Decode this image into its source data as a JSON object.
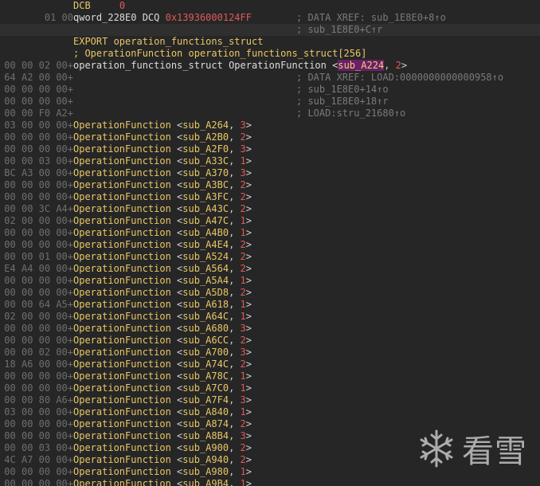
{
  "header_lines": [
    {
      "bytes": "",
      "segments": [
        {
          "t": "DCB",
          "c": "kw"
        },
        {
          "t": "     ",
          "c": "dec"
        },
        {
          "t": "0",
          "c": "num"
        }
      ],
      "comment": ""
    },
    {
      "bytes": "01 00",
      "segments": [
        {
          "t": "qword_228E0 DCQ ",
          "c": "name"
        },
        {
          "t": "0x13936000124FF",
          "c": "hex"
        }
      ],
      "comment": "; DATA XREF: sub_1E8E0+8↑o"
    },
    {
      "bytes": "",
      "segments": [],
      "comment": "; sub_1E8E0+C↑r"
    },
    {
      "bytes": "",
      "segments": [
        {
          "t": "EXPORT operation_functions_struct",
          "c": "kw"
        }
      ],
      "comment": ""
    },
    {
      "bytes": "",
      "segments": [
        {
          "t": "; OperationFunction operation_functions_struct[256]",
          "c": "kw"
        }
      ],
      "comment": ""
    },
    {
      "bytes": "00 00 02 00+",
      "segments": [
        {
          "t": "operation_functions_struct OperationFunction <",
          "c": "name"
        },
        {
          "t": "sub_A224",
          "c": "sub hilite"
        },
        {
          "t": ", ",
          "c": "punct"
        },
        {
          "t": "2",
          "c": "num"
        },
        {
          "t": ">",
          "c": "punct"
        }
      ],
      "comment": ""
    },
    {
      "bytes": "64 A2 00 00+",
      "segments": [],
      "comment": "; DATA XREF: LOAD:0000000000000958↑o"
    },
    {
      "bytes": "00 00 00 00+",
      "segments": [],
      "comment": "; sub_1E8E0+14↑o"
    },
    {
      "bytes": "00 00 00 00+",
      "segments": [],
      "comment": "; sub_1E8E0+18↑r"
    },
    {
      "bytes": "00 00 F0 A2+",
      "segments": [],
      "comment": "; LOAD:stru_21680↑o"
    }
  ],
  "entry_keyword": "OperationFunction",
  "entries": [
    {
      "bytes": "03 00 00 00+",
      "sub": "sub_A264",
      "arg": "3"
    },
    {
      "bytes": "00 00 00 00+",
      "sub": "sub_A2B0",
      "arg": "2"
    },
    {
      "bytes": "00 00 00 00+",
      "sub": "sub_A2F0",
      "arg": "3"
    },
    {
      "bytes": "00 00 03 00+",
      "sub": "sub_A33C",
      "arg": "1"
    },
    {
      "bytes": "BC A3 00 00+",
      "sub": "sub_A370",
      "arg": "3"
    },
    {
      "bytes": "00 00 00 00+",
      "sub": "sub_A3BC",
      "arg": "2"
    },
    {
      "bytes": "00 00 00 00+",
      "sub": "sub_A3FC",
      "arg": "2"
    },
    {
      "bytes": "00 00 3C A4+",
      "sub": "sub_A43C",
      "arg": "2"
    },
    {
      "bytes": "02 00 00 00+",
      "sub": "sub_A47C",
      "arg": "1"
    },
    {
      "bytes": "00 00 00 00+",
      "sub": "sub_A4B0",
      "arg": "1"
    },
    {
      "bytes": "00 00 00 00+",
      "sub": "sub_A4E4",
      "arg": "2"
    },
    {
      "bytes": "00 00 01 00+",
      "sub": "sub_A524",
      "arg": "2"
    },
    {
      "bytes": "E4 A4 00 00+",
      "sub": "sub_A564",
      "arg": "2"
    },
    {
      "bytes": "00 00 00 00+",
      "sub": "sub_A5A4",
      "arg": "1"
    },
    {
      "bytes": "00 00 00 00+",
      "sub": "sub_A5D8",
      "arg": "2"
    },
    {
      "bytes": "00 00 64 A5+",
      "sub": "sub_A618",
      "arg": "1"
    },
    {
      "bytes": "02 00 00 00+",
      "sub": "sub_A64C",
      "arg": "1"
    },
    {
      "bytes": "00 00 00 00+",
      "sub": "sub_A680",
      "arg": "3"
    },
    {
      "bytes": "00 00 00 00+",
      "sub": "sub_A6CC",
      "arg": "2"
    },
    {
      "bytes": "00 00 02 00+",
      "sub": "sub_A700",
      "arg": "3"
    },
    {
      "bytes": "18 A6 00 00+",
      "sub": "sub_A74C",
      "arg": "2"
    },
    {
      "bytes": "00 00 00 00+",
      "sub": "sub_A78C",
      "arg": "1"
    },
    {
      "bytes": "00 00 00 00+",
      "sub": "sub_A7C0",
      "arg": "1"
    },
    {
      "bytes": "00 00 80 A6+",
      "sub": "sub_A7F4",
      "arg": "3"
    },
    {
      "bytes": "03 00 00 00+",
      "sub": "sub_A840",
      "arg": "1"
    },
    {
      "bytes": "00 00 00 00+",
      "sub": "sub_A874",
      "arg": "2"
    },
    {
      "bytes": "00 00 00 00+",
      "sub": "sub_A8B4",
      "arg": "3"
    },
    {
      "bytes": "00 00 03 00+",
      "sub": "sub_A900",
      "arg": "2"
    },
    {
      "bytes": "4C A7 00 00+",
      "sub": "sub_A940",
      "arg": "2"
    },
    {
      "bytes": "00 00 00 00+",
      "sub": "sub_A980",
      "arg": "1"
    },
    {
      "bytes": "00 00 00 00+",
      "sub": "sub_A9B4",
      "arg": "1"
    }
  ],
  "watermark": {
    "text": "看雪",
    "icon": "snowflake-icon"
  },
  "colors": {
    "background": "#262626",
    "highlight_line": "#2f2f2f",
    "keyword": "#e8c766",
    "number": "#e15a5a",
    "comment": "#7a7a7a",
    "bytes": "#6f6f6f",
    "selection": "#6a1f6a"
  }
}
